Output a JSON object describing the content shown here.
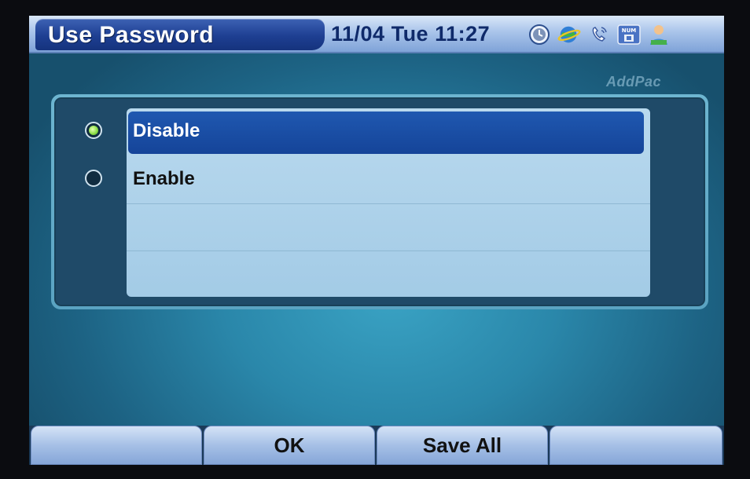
{
  "header": {
    "title": "Use Password",
    "datetime": "11/04 Tue 11:27",
    "status_icons": [
      "clock-icon",
      "network-globe-icon",
      "phone-call-icon",
      "num-lock-icon",
      "user-icon"
    ]
  },
  "brand": "AddPac",
  "options": [
    {
      "label": "Disable",
      "selected": true
    },
    {
      "label": "Enable",
      "selected": false
    }
  ],
  "softkeys": {
    "key1": "",
    "key2": "OK",
    "key3": "Save All",
    "key4": ""
  },
  "colors": {
    "accent": "#154499",
    "radio_active": "#8ee04a",
    "background": "#2a87aa"
  }
}
